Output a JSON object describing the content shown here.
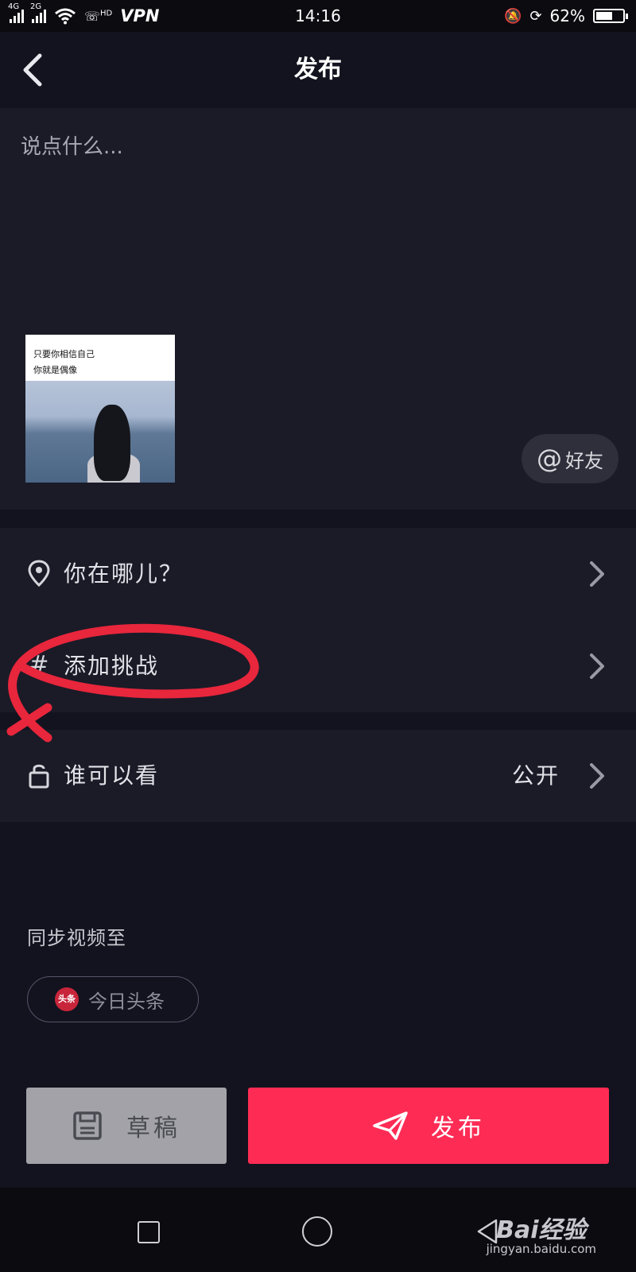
{
  "status_bar": {
    "net1": "4G",
    "net2": "2G",
    "hd": "HD",
    "vpn": "VPN",
    "time": "14:16",
    "battery": "62%",
    "battery_level": 0.62
  },
  "header": {
    "title": "发布"
  },
  "caption": {
    "placeholder": "说点什么...",
    "thumbnail_text": [
      "只要你相信自己",
      "你就是偶像"
    ],
    "mention_label": "好友"
  },
  "options": [
    {
      "label": "你在哪儿？",
      "value": ""
    },
    {
      "label": "添加挑战",
      "value": ""
    },
    {
      "label": "谁可以看",
      "value": "公开"
    }
  ],
  "sync": {
    "label": "同步视频至",
    "platform_icon_text": "头条",
    "platform": "今日头条"
  },
  "actions": {
    "draft": "草稿",
    "publish": "发布"
  },
  "watermark": {
    "brand": "Bai经验",
    "url": "jingyan.baidu.com"
  },
  "colors": {
    "accent": "#fe2c55",
    "background": "#13131f",
    "panel": "#1a1b27",
    "annotation": "#e8263c"
  },
  "icons": [
    "back-arrow",
    "location-pin",
    "hashtag",
    "unlock",
    "chevron-right",
    "save-disk",
    "paper-plane"
  ]
}
